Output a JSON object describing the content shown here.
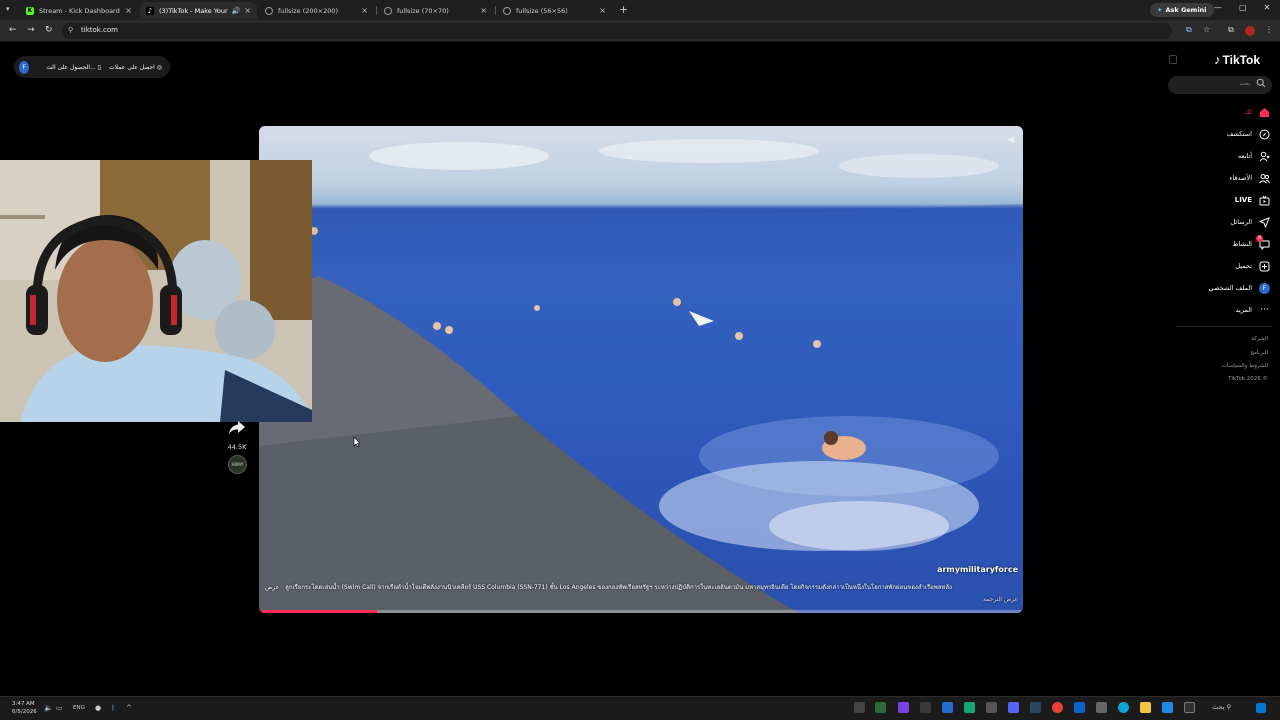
{
  "browser": {
    "tabs": [
      {
        "label": "Stream - Kick Dashboard",
        "favicon_color": "#53fc18",
        "favicon_letter": "K",
        "active": false
      },
      {
        "label": "(3)TikTok - Make Your Day",
        "favicon_color": "#000000",
        "favicon_letter": "♪",
        "active": true
      },
      {
        "label": "fullsize (200×200)",
        "favicon_color": "#555555",
        "favicon_letter": "",
        "active": false
      },
      {
        "label": "fullsize (70×70)",
        "favicon_color": "#555555",
        "favicon_letter": "",
        "active": false
      },
      {
        "label": "fullsize (56×56)",
        "favicon_color": "#555555",
        "favicon_letter": "",
        "active": false
      }
    ],
    "ask_gemini": "Ask Gemini",
    "url": "tiktok.com"
  },
  "top_pill": {
    "avatar_letter": "F",
    "item1": "الحصول على الت...",
    "item2": "احصل على عملات"
  },
  "sidebar": {
    "logo": "TikTok",
    "search_placeholder": "بحث",
    "nav": [
      {
        "label": "لك",
        "icon": "home-icon",
        "active": true
      },
      {
        "label": "استكشف",
        "icon": "compass-icon",
        "active": false
      },
      {
        "label": "أتابعه",
        "icon": "following-icon",
        "active": false
      },
      {
        "label": "الأصدقاء",
        "icon": "friends-icon",
        "active": false
      },
      {
        "label": "LIVE",
        "icon": "live-icon",
        "active": false
      },
      {
        "label": "الرسائل",
        "icon": "messages-icon",
        "active": false
      },
      {
        "label": "النشاط",
        "icon": "activity-icon",
        "active": false,
        "badge": "9"
      },
      {
        "label": "تحميل",
        "icon": "upload-icon",
        "active": false
      },
      {
        "label": "الملف الشخصي",
        "icon": "profile-icon",
        "active": false
      },
      {
        "label": "المزيد",
        "icon": "more-icon",
        "active": false
      }
    ],
    "profile_letter": "F",
    "footer": [
      "الشركة",
      "البرنامج",
      "الشروط والسياسات",
      "TikTok 2026 ©"
    ]
  },
  "video": {
    "author": "armymilitaryforce",
    "caption": "ลูกเรือกระโดดเล่นน้ำ (Swim Call) จากเรือดำน้ำโจมตีพลังงานนิวเคลียร์ USS Columbia (SSN-771) ชั้น Los Angeles ของกองทัพเรือสหรัฐฯ ระหว่างปฏิบัติการในทะเลอันดามัน มหาสมุทรอินเดีย โดยกิจกรรมดังกล่าวเป็นหนึ่งในโอกาสพักผ่อนของลำเรือพลหลัง",
    "caption_more": "عرض الترجمة",
    "caption_prefix": "عرض",
    "progress": 0.155,
    "progress_color": "#fe2c55",
    "share_count": "44.5K",
    "author_avatar_text": "ARMY"
  },
  "taskbar": {
    "time": "3:47 AM",
    "date": "6/5/2026",
    "lang": "ENG",
    "search_label": "بحث"
  }
}
